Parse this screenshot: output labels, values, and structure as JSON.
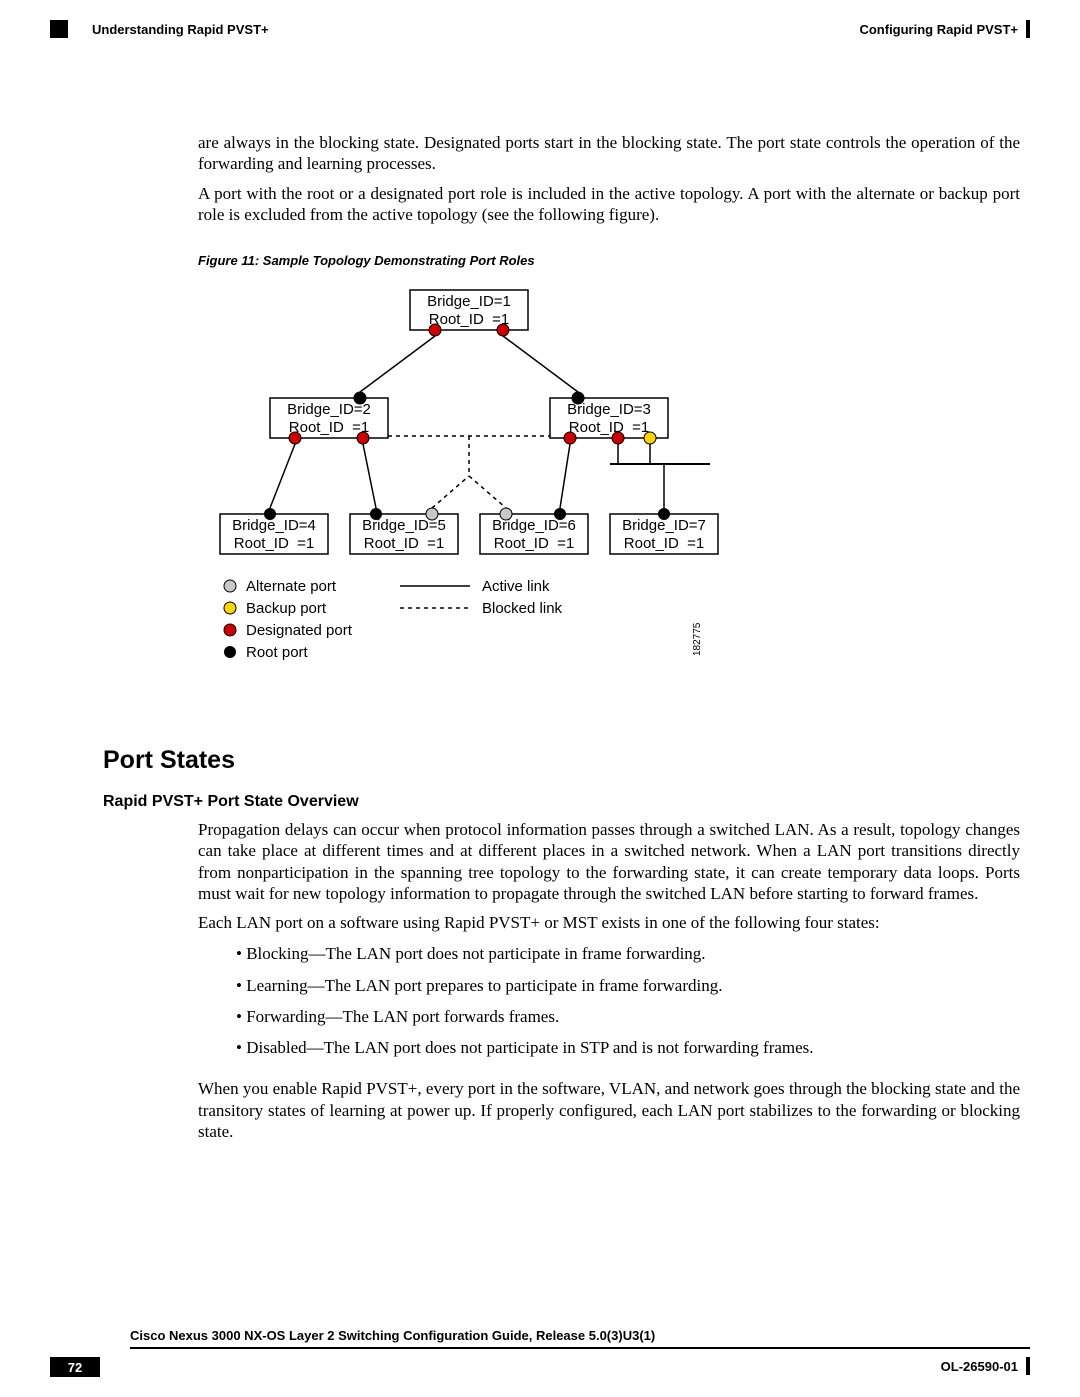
{
  "header": {
    "section": "Understanding Rapid PVST+",
    "chapter": "Configuring Rapid PVST+"
  },
  "body": {
    "p1": "are always in the blocking state. Designated ports start in the blocking state. The port state controls the operation of the forwarding and learning processes.",
    "p2": "A port with the root or a designated port role is included in the active topology. A port with the alternate or backup port role is excluded from the active topology (see the following figure).",
    "fig_caption": "Figure 11: Sample Topology Demonstrating Port Roles",
    "h2": "Port States",
    "h3": "Rapid PVST+ Port State Overview",
    "p3": "Propagation delays can occur when protocol information passes through a switched LAN. As a result, topology changes can take place at different times and at different places in a switched network. When a LAN port transitions directly from nonparticipation in the spanning tree topology to the forwarding state, it can create temporary data loops. Ports must wait for new topology information to propagate through the switched LAN before starting to forward frames.",
    "p4": "Each LAN port on a software using Rapid PVST+ or MST exists in one of the following four states:",
    "bullets": [
      "Blocking—The LAN port does not participate in frame forwarding.",
      "Learning—The LAN port prepares to participate in frame forwarding.",
      "Forwarding—The LAN port forwards frames.",
      "Disabled—The LAN port does not participate in STP and is not forwarding frames."
    ],
    "p5": "When you enable Rapid PVST+, every port in the software, VLAN, and network goes through the blocking state and the transitory states of learning at power up. If properly configured, each LAN port stabilizes to the forwarding or blocking state."
  },
  "diagram": {
    "bridges": [
      {
        "id": 1,
        "lines": [
          "Bridge_ID=1",
          "Root_ID  =1"
        ]
      },
      {
        "id": 2,
        "lines": [
          "Bridge_ID=2",
          "Root_ID  =1"
        ]
      },
      {
        "id": 3,
        "lines": [
          "Bridge_ID=3",
          "Root_ID  =1"
        ]
      },
      {
        "id": 4,
        "lines": [
          "Bridge_ID=4",
          "Root_ID  =1"
        ]
      },
      {
        "id": 5,
        "lines": [
          "Bridge_ID=5",
          "Root_ID  =1"
        ]
      },
      {
        "id": 6,
        "lines": [
          "Bridge_ID=6",
          "Root_ID  =1"
        ]
      },
      {
        "id": 7,
        "lines": [
          "Bridge_ID=7",
          "Root_ID  =1"
        ]
      }
    ],
    "legend": {
      "alternate": "Alternate port",
      "backup": "Backup port",
      "designated": "Designated port",
      "root": "Root port",
      "active_link": "Active link",
      "blocked_link": "Blocked link"
    },
    "image_num": "182775"
  },
  "footer": {
    "book": "Cisco Nexus 3000 NX-OS Layer 2 Switching Configuration Guide, Release 5.0(3)U3(1)",
    "page": "72",
    "doc": "OL-26590-01"
  }
}
